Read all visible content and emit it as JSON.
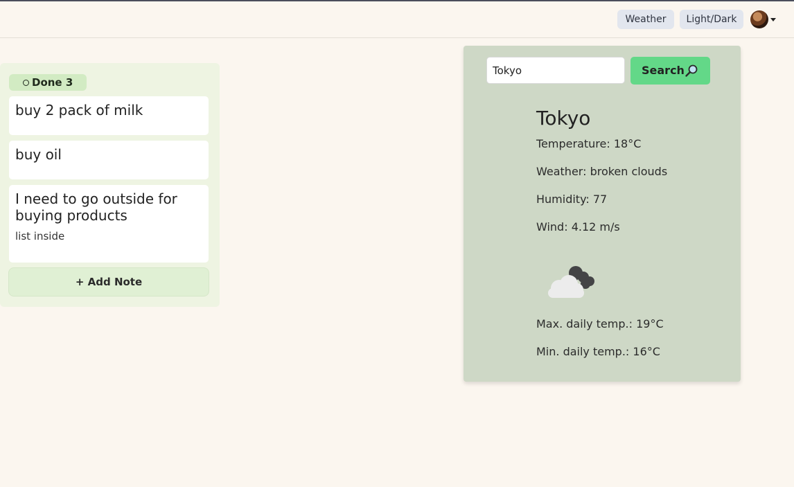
{
  "nav": {
    "weather_label": "Weather",
    "theme_label": "Light/Dark"
  },
  "column": {
    "badge_label": "Done 3",
    "notes": [
      {
        "title": "buy 2 pack of milk",
        "body": ""
      },
      {
        "title": "buy oil",
        "body": ""
      },
      {
        "title": "I need to go outside for buying products",
        "body": "list inside"
      }
    ],
    "add_label": "+ Add Note"
  },
  "weather": {
    "input_value": "Tokyo",
    "search_label": "Search",
    "city": "Tokyo",
    "temperature": "Temperature: 18°C",
    "description": "Weather: broken clouds",
    "humidity": "Humidity: 77",
    "wind": "Wind: 4.12 m/s",
    "icon": "cloud-icon",
    "max_temp": "Max. daily temp.: 19°C",
    "min_temp": "Min. daily temp.: 16°C"
  },
  "colors": {
    "background": "#fbf6ef",
    "column_bg": "#eef4e2",
    "weather_panel_bg": "#ced8c6",
    "search_button": "#63d888"
  }
}
